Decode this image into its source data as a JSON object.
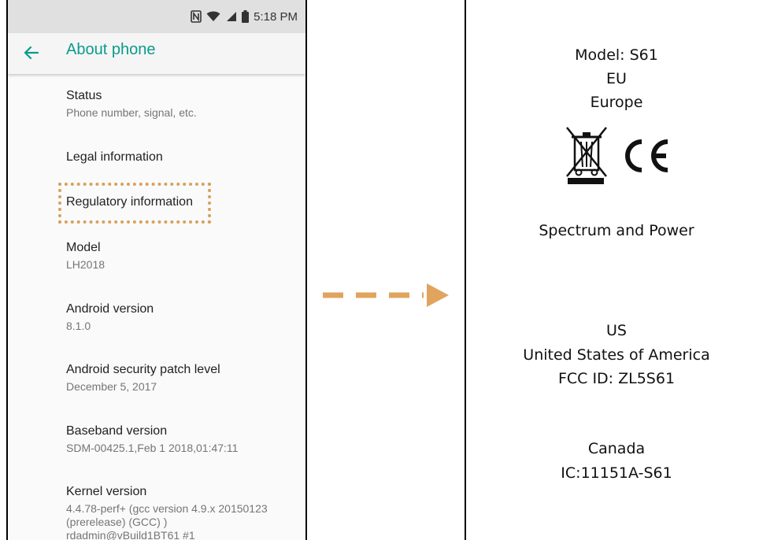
{
  "status_bar": {
    "time": "5:18 PM"
  },
  "app_bar": {
    "title": "About phone",
    "back_icon": "arrow-left-icon"
  },
  "settings": [
    {
      "primary": "Status",
      "secondary": "Phone number, signal, etc."
    },
    {
      "primary": "Legal information",
      "secondary": ""
    },
    {
      "primary": "Regulatory information",
      "secondary": ""
    },
    {
      "primary": "Model",
      "secondary": "LH2018"
    },
    {
      "primary": "Android version",
      "secondary": "8.1.0"
    },
    {
      "primary": "Android security patch level",
      "secondary": "December 5, 2017"
    },
    {
      "primary": "Baseband version",
      "secondary": "SDM-00425.1,Feb  1 2018,01:47:11"
    },
    {
      "primary": "Kernel version",
      "secondary_lines": [
        "4.4.78-perf+ (gcc version 4.9.x 20150123",
        "(prerelease) (GCC) )",
        "rdadmin@vBuild1BT61 #1"
      ]
    }
  ],
  "regulatory": {
    "model": "Model: S61",
    "eu_code": "EU",
    "eu_name": "Europe",
    "spectrum": "Spectrum and Power",
    "us_code": "US",
    "us_name": "United States of America",
    "fcc_id": "FCC ID: ZL5S61",
    "canada": "Canada",
    "ic": "IC:11151A-S61"
  },
  "colors": {
    "accent": "#0a9b8b",
    "highlight": "#d9a05a",
    "arrow": "#e0a45f"
  }
}
